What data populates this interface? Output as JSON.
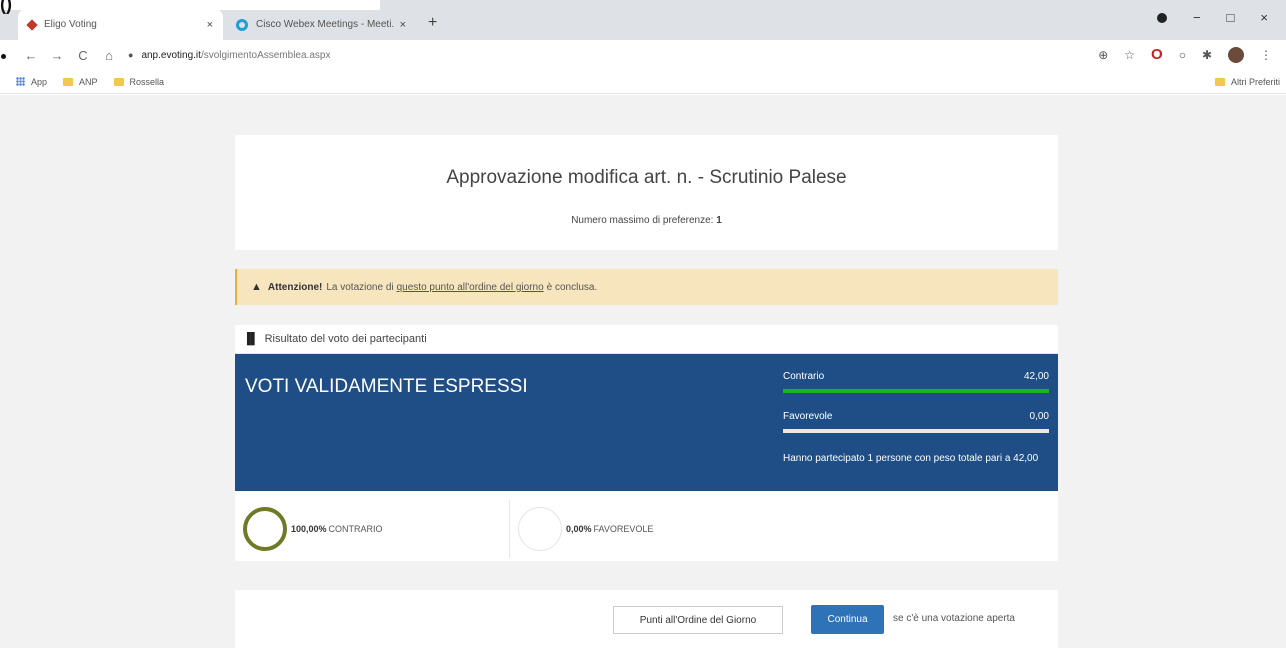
{
  "corner": {
    "glyph": "()"
  },
  "browser": {
    "tabs": [
      {
        "title": "Eligo Voting",
        "close": "×"
      },
      {
        "title": "Cisco Webex Meetings - Meeti...",
        "close": "×"
      }
    ],
    "new_tab": "+",
    "window_controls": {
      "minimize": "−",
      "maximize": "□",
      "close": "×"
    },
    "nav": {
      "back": "←",
      "forward": "→",
      "reload": "C",
      "home": "⌂"
    },
    "address": {
      "domain": "anp.evoting.it",
      "path": "/svolgimentoAssemblea.aspx"
    },
    "toolbar_icons": {
      "zoom": "⊕",
      "star": "☆",
      "opera": "O",
      "circle": "○",
      "puzzle": "✱",
      "menu": "⋮"
    },
    "bookmarks": [
      {
        "label": "App",
        "icon": "apps-grid-icon"
      },
      {
        "label": "ANP",
        "icon": "folder-icon"
      },
      {
        "label": "Rossella",
        "icon": "folder-icon"
      }
    ],
    "other_bookmarks": "Altri Preferiti"
  },
  "vote": {
    "title": "Approvazione modifica art. n. - Scrutinio Palese",
    "max_pref_label": "Numero massimo di preferenze:",
    "max_pref_value": "1"
  },
  "alert": {
    "icon": "▲",
    "strong": "Attenzione!",
    "text_before": "La votazione di",
    "link": "questo punto all'ordine del giorno",
    "text_after": "è conclusa."
  },
  "results": {
    "header": "Risultato del voto dei partecipanti",
    "banner": "VOTI VALIDAMENTE ESPRESSI",
    "stats": [
      {
        "label": "Contrario",
        "value": "42,00",
        "fraction": 1.0
      },
      {
        "label": "Favorevole",
        "value": "0,00",
        "fraction": 0.0
      }
    ],
    "summary": "Hanno partecipato 1 persone con peso totale pari a 42,00",
    "donuts": [
      {
        "percent": "100,00%",
        "label": "CONTRARIO"
      },
      {
        "percent": "0,00%",
        "label": "FAVOREVOLE"
      }
    ]
  },
  "footer": {
    "agenda_button": "Punti all'Ordine del Giorno",
    "continue_button": "Continua",
    "hint": "se c'è una votazione aperta"
  }
}
